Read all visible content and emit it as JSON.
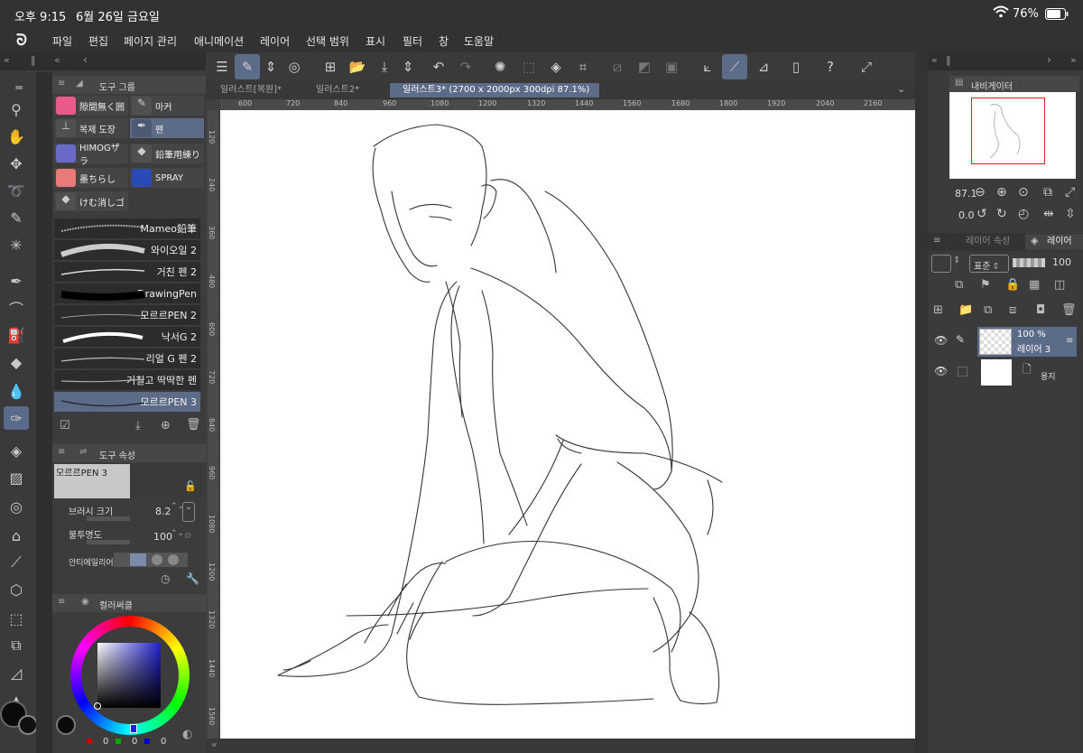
{
  "status": {
    "time": "오후 9:15",
    "date": "6월 26일 금요일",
    "wifi": "wifi-icon",
    "battery": "76%"
  },
  "menu": {
    "logo": "clip-studio-logo-icon",
    "items": [
      "파일",
      "편집",
      "페이지 관리",
      "애니메이션",
      "레이어",
      "선택 범위",
      "표시",
      "필터",
      "창",
      "도움말"
    ]
  },
  "subtool_panel": {
    "title": "도구 그룹",
    "groups": [
      {
        "label": "隙間無く囲",
        "color": "#e85a8a"
      },
      {
        "label": "마커",
        "color": "#5a5a5a"
      },
      {
        "label": "복제 도장",
        "color": "#5a5a5a"
      },
      {
        "label": "펜",
        "color": "#5a5a5a"
      },
      {
        "label": "HIMOGザラ",
        "color": "#6a6ac8"
      },
      {
        "label": "鉛筆用練り",
        "color": "#5a5a5a"
      },
      {
        "label": "墨ちらし",
        "color": "#e87a7a"
      },
      {
        "label": "SPRAY",
        "color": "#2a4ab8"
      },
      {
        "label": "けむ消しゴ",
        "color": "#5a5a5a"
      }
    ],
    "brushes": [
      "Mameo鉛筆",
      "와이오일 2",
      "거친 펜 2",
      "DrawingPen",
      "모르르PEN 2",
      "낙서G 2",
      "리얼 G 펜 2",
      "거칠고 딱딱한 펜",
      "모르르PEN 3"
    ]
  },
  "tool_property": {
    "title": "도구 속성",
    "preview_name": "모르르PEN 3",
    "brush_size_label": "브러시 크기",
    "brush_size": "8.2",
    "opacity_label": "불투명도",
    "opacity": "100",
    "antialias_label": "안티에일리어"
  },
  "color_panel": {
    "title": "컬러써클",
    "r": "0",
    "g": "0",
    "b": "0",
    "main_color": "#0a0a0a"
  },
  "document_tabs": [
    {
      "label": "일러스트[복원]*",
      "active": false
    },
    {
      "label": "일러스트2*",
      "active": false
    },
    {
      "label": "일러스트3* (2700 x 2000px 300dpi 87.1%)",
      "active": true
    }
  ],
  "ruler": {
    "top": [
      "600",
      "720",
      "840",
      "960",
      "1080",
      "1200",
      "1320",
      "1440",
      "1560",
      "1680",
      "1800",
      "1920",
      "2040",
      "2160"
    ],
    "left": [
      "120",
      "240",
      "360",
      "480",
      "600",
      "720",
      "840",
      "960",
      "1080",
      "1200",
      "1320",
      "1440",
      "1560"
    ]
  },
  "navigator": {
    "title": "내비게이터",
    "zoom": "87.1",
    "rotation": "0.0"
  },
  "layers": {
    "tab_property": "레이어 속성",
    "tab_layer": "레이어",
    "blend": "표준",
    "opacity": "100",
    "items": [
      {
        "percent": "100 %",
        "name": "레이어 3",
        "selected": true
      },
      {
        "percent": "",
        "name": "용지",
        "selected": false
      }
    ]
  }
}
